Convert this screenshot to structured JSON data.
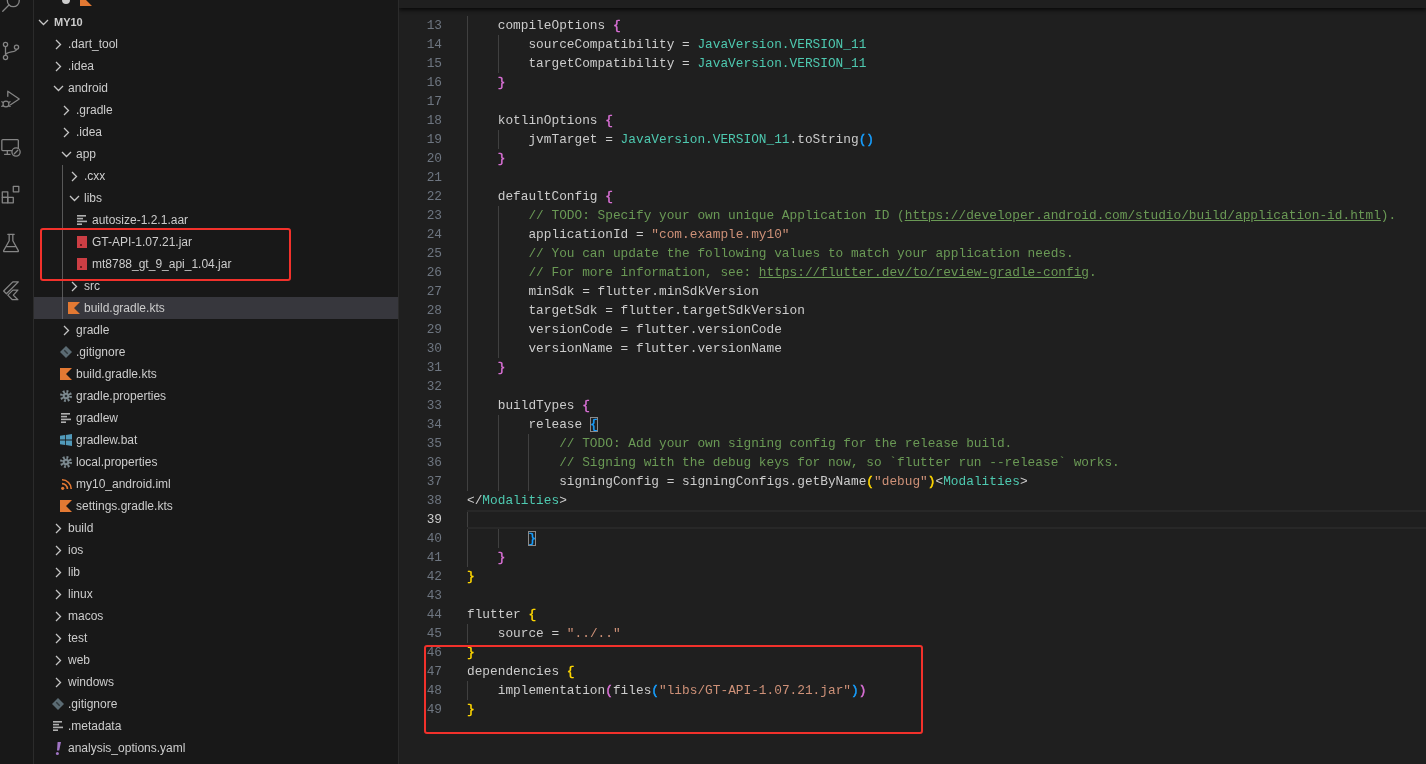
{
  "activity_bar": {
    "items": [
      {
        "kind": "search"
      },
      {
        "kind": "branch"
      },
      {
        "kind": "debug"
      },
      {
        "kind": "remote"
      },
      {
        "kind": "extensions"
      },
      {
        "kind": "testing"
      },
      {
        "kind": "flutter"
      }
    ]
  },
  "explorer": {
    "open_editor": {
      "kind": "kotlin",
      "dirty": true
    },
    "root": {
      "name": "MY10",
      "expanded": true
    },
    "items": [
      {
        "name": ".dart_tool",
        "kind": "folder",
        "expanded": false,
        "selected": false
      },
      {
        "name": ".idea",
        "kind": "folder",
        "expanded": false,
        "selected": false
      },
      {
        "name": "android",
        "kind": "folder",
        "expanded": true,
        "selected": false,
        "children": [
          {
            "name": ".gradle",
            "kind": "folder",
            "expanded": false,
            "selected": false
          },
          {
            "name": ".idea",
            "kind": "folder",
            "expanded": false,
            "selected": false
          },
          {
            "name": "app",
            "kind": "folder",
            "expanded": true,
            "selected": false,
            "children": [
              {
                "name": ".cxx",
                "kind": "folder",
                "expanded": false,
                "selected": false
              },
              {
                "name": "libs",
                "kind": "folder",
                "expanded": true,
                "selected": false,
                "children": [
                  {
                    "name": "autosize-1.2.1.aar",
                    "kind": "text",
                    "selected": false,
                    "framed": false
                  },
                  {
                    "name": "GT-API-1.07.21.jar",
                    "kind": "jar",
                    "selected": false,
                    "framed": true
                  },
                  {
                    "name": "mt8788_gt_9_api_1.04.jar",
                    "kind": "jar",
                    "selected": false,
                    "framed": true
                  }
                ]
              },
              {
                "name": "src",
                "kind": "folder",
                "expanded": false,
                "selected": false
              },
              {
                "name": "build.gradle.kts",
                "kind": "kotlin",
                "selected": true
              }
            ]
          },
          {
            "name": "gradle",
            "kind": "folder",
            "expanded": false,
            "selected": false
          },
          {
            "name": ".gitignore",
            "kind": "git",
            "selected": false
          },
          {
            "name": "build.gradle.kts",
            "kind": "kotlin",
            "selected": false
          },
          {
            "name": "gradle.properties",
            "kind": "gear",
            "selected": false
          },
          {
            "name": "gradlew",
            "kind": "text",
            "selected": false
          },
          {
            "name": "gradlew.bat",
            "kind": "windows",
            "selected": false
          },
          {
            "name": "local.properties",
            "kind": "gear",
            "selected": false
          },
          {
            "name": "my10_android.iml",
            "kind": "feed",
            "selected": false
          },
          {
            "name": "settings.gradle.kts",
            "kind": "kotlin",
            "selected": false
          }
        ]
      },
      {
        "name": "build",
        "kind": "folder",
        "expanded": false,
        "selected": false
      },
      {
        "name": "ios",
        "kind": "folder",
        "expanded": false,
        "selected": false
      },
      {
        "name": "lib",
        "kind": "folder",
        "expanded": false,
        "selected": false
      },
      {
        "name": "linux",
        "kind": "folder",
        "expanded": false,
        "selected": false
      },
      {
        "name": "macos",
        "kind": "folder",
        "expanded": false,
        "selected": false
      },
      {
        "name": "test",
        "kind": "folder",
        "expanded": false,
        "selected": false
      },
      {
        "name": "web",
        "kind": "folder",
        "expanded": false,
        "selected": false
      },
      {
        "name": "windows",
        "kind": "folder",
        "expanded": false,
        "selected": false
      },
      {
        "name": ".gitignore",
        "kind": "git",
        "selected": false
      },
      {
        "name": ".metadata",
        "kind": "text",
        "selected": false
      },
      {
        "name": "analysis_options.yaml",
        "kind": "yaml",
        "selected": false
      }
    ]
  },
  "editor": {
    "lines": [
      {
        "number": "13",
        "current": false,
        "framed": false,
        "tokens": [
          {
            "text": "    compileOptions ",
            "kind": "plain"
          },
          {
            "text": "{",
            "kind": "bracket",
            "color": "#da70d6"
          }
        ]
      },
      {
        "number": "14",
        "current": false,
        "framed": false,
        "tokens": [
          {
            "text": "        sourceCompatibility = ",
            "kind": "plain"
          },
          {
            "text": "JavaVersion.VERSION_11",
            "kind": "type"
          }
        ]
      },
      {
        "number": "15",
        "current": false,
        "framed": false,
        "tokens": [
          {
            "text": "        targetCompatibility = ",
            "kind": "plain"
          },
          {
            "text": "JavaVersion.VERSION_11",
            "kind": "type"
          }
        ]
      },
      {
        "number": "16",
        "current": false,
        "framed": false,
        "tokens": [
          {
            "text": "    }",
            "kind": "bracket",
            "color": "#da70d6"
          }
        ]
      },
      {
        "number": "17",
        "current": false,
        "framed": false
      },
      {
        "number": "18",
        "current": false,
        "framed": false,
        "tokens": [
          {
            "text": "    kotlinOptions ",
            "kind": "plain"
          },
          {
            "text": "{",
            "kind": "bracket",
            "color": "#da70d6"
          }
        ]
      },
      {
        "number": "19",
        "current": false,
        "framed": false,
        "tokens": [
          {
            "text": "        jvmTarget = ",
            "kind": "plain"
          },
          {
            "text": "JavaVersion.VERSION_11",
            "kind": "type"
          },
          {
            "text": ".toString",
            "kind": "plain"
          },
          {
            "text": "()",
            "kind": "bracket",
            "color": "#179fff"
          }
        ]
      },
      {
        "number": "20",
        "current": false,
        "framed": false,
        "tokens": [
          {
            "text": "    }",
            "kind": "bracket",
            "color": "#da70d6"
          }
        ]
      },
      {
        "number": "21",
        "current": false,
        "framed": false
      },
      {
        "number": "22",
        "current": false,
        "framed": false,
        "tokens": [
          {
            "text": "    defaultConfig ",
            "kind": "plain"
          },
          {
            "text": "{",
            "kind": "bracket",
            "color": "#da70d6"
          }
        ]
      },
      {
        "number": "23",
        "current": false,
        "framed": false,
        "tokens": [
          {
            "text": "        // TODO: Specify your own unique Application ID (",
            "kind": "comment"
          },
          {
            "text": "https://developer.android.com/studio/build/application-id.html",
            "kind": "link"
          },
          {
            "text": ").",
            "kind": "comment"
          }
        ]
      },
      {
        "number": "24",
        "current": false,
        "framed": false,
        "tokens": [
          {
            "text": "        applicationId = ",
            "kind": "plain"
          },
          {
            "text": "\"com.example.my10\"",
            "kind": "string"
          }
        ]
      },
      {
        "number": "25",
        "current": false,
        "framed": false,
        "tokens": [
          {
            "text": "        // You can update the following values to match your application needs.",
            "kind": "comment"
          }
        ]
      },
      {
        "number": "26",
        "current": false,
        "framed": false,
        "tokens": [
          {
            "text": "        // For more information, see: ",
            "kind": "comment"
          },
          {
            "text": "https://flutter.dev/to/review-gradle-config",
            "kind": "link"
          },
          {
            "text": ".",
            "kind": "comment"
          }
        ]
      },
      {
        "number": "27",
        "current": false,
        "framed": false,
        "tokens": [
          {
            "text": "        minSdk = flutter.minSdkVersion",
            "kind": "plain"
          }
        ]
      },
      {
        "number": "28",
        "current": false,
        "framed": false,
        "tokens": [
          {
            "text": "        targetSdk = flutter.targetSdkVersion",
            "kind": "plain"
          }
        ]
      },
      {
        "number": "29",
        "current": false,
        "framed": false,
        "tokens": [
          {
            "text": "        versionCode = flutter.versionCode",
            "kind": "plain"
          }
        ]
      },
      {
        "number": "30",
        "current": false,
        "framed": false,
        "tokens": [
          {
            "text": "        versionName = flutter.versionName",
            "kind": "plain"
          }
        ]
      },
      {
        "number": "31",
        "current": false,
        "framed": false,
        "tokens": [
          {
            "text": "    }",
            "kind": "bracket",
            "color": "#da70d6"
          }
        ]
      },
      {
        "number": "32",
        "current": false,
        "framed": false
      },
      {
        "number": "33",
        "current": false,
        "framed": false,
        "tokens": [
          {
            "text": "    buildTypes ",
            "kind": "plain"
          },
          {
            "text": "{",
            "kind": "bracket",
            "color": "#da70d6"
          }
        ]
      },
      {
        "number": "34",
        "current": false,
        "framed": false,
        "tokens": [
          {
            "text": "        release ",
            "kind": "plain"
          },
          {
            "text": "{",
            "kind": "matched",
            "color": "#179fff"
          }
        ]
      },
      {
        "number": "35",
        "current": false,
        "framed": false,
        "tokens": [
          {
            "text": "            // TODO: Add your own signing config for the release build.",
            "kind": "comment"
          }
        ]
      },
      {
        "number": "36",
        "current": false,
        "framed": false,
        "tokens": [
          {
            "text": "            // Signing with the debug keys for now, so `flutter run --release` works.",
            "kind": "comment"
          }
        ]
      },
      {
        "number": "37",
        "current": false,
        "framed": false,
        "tokens": [
          {
            "text": "            signingConfig = signingConfigs.getByName",
            "kind": "plain"
          },
          {
            "text": "(",
            "kind": "bracket",
            "color": "#ffd700"
          },
          {
            "text": "\"debug\"",
            "kind": "string"
          },
          {
            "text": ")",
            "kind": "bracket",
            "color": "#ffd700"
          },
          {
            "text": "<",
            "kind": "plain"
          },
          {
            "text": "Modalities",
            "kind": "type"
          },
          {
            "text": ">",
            "kind": "plain"
          }
        ]
      },
      {
        "number": "38",
        "current": false,
        "framed": false,
        "tokens": [
          {
            "text": "</",
            "kind": "plain"
          },
          {
            "text": "Modalities",
            "kind": "type"
          },
          {
            "text": ">",
            "kind": "plain"
          }
        ]
      },
      {
        "number": "39",
        "current": true,
        "framed": false
      },
      {
        "number": "40",
        "current": false,
        "framed": false,
        "tokens": [
          {
            "text": "        }",
            "kind": "matched",
            "color": "#179fff"
          }
        ]
      },
      {
        "number": "41",
        "current": false,
        "framed": false,
        "tokens": [
          {
            "text": "    }",
            "kind": "bracket",
            "color": "#da70d6"
          }
        ]
      },
      {
        "number": "42",
        "current": false,
        "framed": false,
        "tokens": [
          {
            "text": "}",
            "kind": "bracket",
            "color": "#ffd700"
          }
        ]
      },
      {
        "number": "43",
        "current": false,
        "framed": false
      },
      {
        "number": "44",
        "current": false,
        "framed": false,
        "tokens": [
          {
            "text": "flutter ",
            "kind": "plain"
          },
          {
            "text": "{",
            "kind": "bracket",
            "color": "#ffd700"
          }
        ]
      },
      {
        "number": "45",
        "current": false,
        "framed": false,
        "tokens": [
          {
            "text": "    source = ",
            "kind": "plain"
          },
          {
            "text": "\"../..\"",
            "kind": "string"
          }
        ]
      },
      {
        "number": "46",
        "current": false,
        "framed": true,
        "tokens": [
          {
            "text": "}",
            "kind": "bracket",
            "color": "#ffd700"
          }
        ]
      },
      {
        "number": "47",
        "current": false,
        "framed": true,
        "tokens": [
          {
            "text": "dependencies ",
            "kind": "plain"
          },
          {
            "text": "{",
            "kind": "bracket",
            "color": "#ffd700"
          }
        ]
      },
      {
        "number": "48",
        "current": false,
        "framed": true,
        "tokens": [
          {
            "text": "    implementation",
            "kind": "plain"
          },
          {
            "text": "(",
            "kind": "bracket",
            "color": "#da70d6"
          },
          {
            "text": "files",
            "kind": "plain"
          },
          {
            "text": "(",
            "kind": "bracket",
            "color": "#179fff"
          },
          {
            "text": "\"libs/GT-API-1.07.21.jar\"",
            "kind": "string"
          },
          {
            "text": ")",
            "kind": "bracket",
            "color": "#179fff"
          },
          {
            "text": ")",
            "kind": "bracket",
            "color": "#da70d6"
          }
        ]
      },
      {
        "number": "49",
        "current": false,
        "framed": true,
        "tokens": [
          {
            "text": "}",
            "kind": "bracket",
            "color": "#ffd700"
          }
        ]
      }
    ]
  }
}
